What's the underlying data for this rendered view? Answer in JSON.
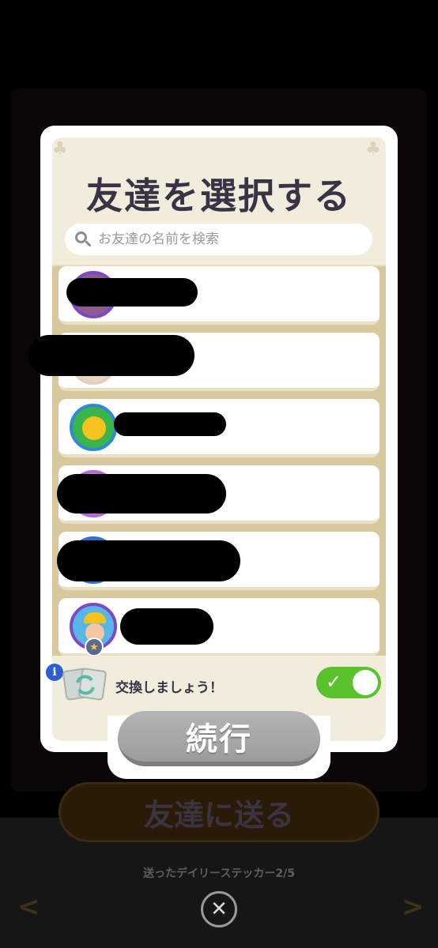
{
  "modal": {
    "title": "友達を選択する",
    "search_placeholder": "お友達の名前を検索",
    "trade_label": "交換しましょう！",
    "trade_toggle_on": true,
    "continue_label": "続行",
    "friends": [
      {
        "name": "",
        "avatar": "purple-frame-avatar"
      },
      {
        "name": "",
        "avatar": "redacted-avatar"
      },
      {
        "name": "",
        "avatar": "yellow-dog-avatar"
      },
      {
        "name": "",
        "avatar": "rainbow-avatar"
      },
      {
        "name": "",
        "avatar": "blue-avatar"
      },
      {
        "name": "",
        "avatar": "boy-avatar",
        "badge": "star-badge"
      }
    ]
  },
  "background": {
    "send_button_label": "友達に送る",
    "sticker_count_label": "送ったデイリーステッカー2/5",
    "prev_arrow": "<",
    "next_arrow": ">",
    "close_icon": "✕"
  },
  "colors": {
    "title": "#3a3346",
    "toggle_on": "#57c22c",
    "continue_disabled": "#a8a8a8",
    "panel": "#f1ecdc",
    "list_border": "#d7c89d"
  }
}
